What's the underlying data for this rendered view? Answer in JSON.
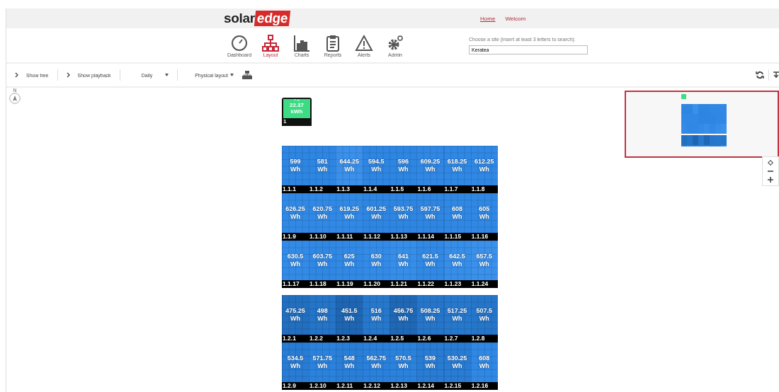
{
  "header": {
    "logo": {
      "part_1": "solar",
      "part_2": "edge"
    },
    "links": [
      {
        "label": "Home",
        "kind": "link"
      },
      {
        "label": "Welcom",
        "kind": "text"
      }
    ]
  },
  "nav": [
    {
      "label": "Dashboard",
      "kind": "gauge",
      "selected": false
    },
    {
      "label": "Layout",
      "kind": "tree",
      "selected": true
    },
    {
      "label": "Charts",
      "kind": "bars",
      "selected": false
    },
    {
      "label": "Reports",
      "kind": "clipboard",
      "selected": false
    },
    {
      "label": "Alerts",
      "kind": "warning",
      "selected": false
    },
    {
      "label": "Admin",
      "kind": "gears",
      "selected": false
    }
  ],
  "site_search": {
    "label": "Choose a site (insert at least 3 letters to search):",
    "value": "Keratea"
  },
  "toolbar": [
    {
      "label": "Show tree",
      "kind": "toggle"
    },
    {
      "label": "Show playback",
      "kind": "toggle"
    },
    {
      "label": "Daily",
      "kind": "dropdown"
    },
    {
      "label": "Physical layout",
      "kind": "menu"
    }
  ],
  "compass": {
    "label": "N"
  },
  "inverter": {
    "value": "22.37",
    "unit": "kWh",
    "id": "1"
  },
  "strings": [
    {
      "rows": [
        [
          {
            "value": "599",
            "unit": "Wh",
            "id": "1.1.1",
            "color": "#2e86e2"
          },
          {
            "value": "581",
            "unit": "Wh",
            "id": "1.1.2",
            "color": "#2e86e2"
          },
          {
            "value": "644.25",
            "unit": "Wh",
            "id": "1.1.3",
            "color": "#3a90ea"
          },
          {
            "value": "594.5",
            "unit": "Wh",
            "id": "1.1.4",
            "color": "#2e86e2"
          },
          {
            "value": "596",
            "unit": "Wh",
            "id": "1.1.5",
            "color": "#2e86e2"
          },
          {
            "value": "609.25",
            "unit": "Wh",
            "id": "1.1.6",
            "color": "#3088e4"
          },
          {
            "value": "618.25",
            "unit": "Wh",
            "id": "1.1.7",
            "color": "#3088e4"
          },
          {
            "value": "612.25",
            "unit": "Wh",
            "id": "1.1.8",
            "color": "#3088e4"
          }
        ],
        [
          {
            "value": "626.25",
            "unit": "Wh",
            "id": "1.1.9",
            "color": "#3189e5"
          },
          {
            "value": "620.75",
            "unit": "Wh",
            "id": "1.1.10",
            "color": "#3189e5"
          },
          {
            "value": "619.25",
            "unit": "Wh",
            "id": "1.1.11",
            "color": "#3189e5"
          },
          {
            "value": "601.25",
            "unit": "Wh",
            "id": "1.1.12",
            "color": "#2e86e2"
          },
          {
            "value": "593.75",
            "unit": "Wh",
            "id": "1.1.13",
            "color": "#2e86e2"
          },
          {
            "value": "597.75",
            "unit": "Wh",
            "id": "1.1.14",
            "color": "#2e86e2"
          },
          {
            "value": "608",
            "unit": "Wh",
            "id": "1.1.15",
            "color": "#3088e4"
          },
          {
            "value": "605",
            "unit": "Wh",
            "id": "1.1.16",
            "color": "#3088e4"
          }
        ],
        [
          {
            "value": "630.5",
            "unit": "Wh",
            "id": "1.1.17",
            "color": "#338be7"
          },
          {
            "value": "603.75",
            "unit": "Wh",
            "id": "1.1.18",
            "color": "#3088e4"
          },
          {
            "value": "625",
            "unit": "Wh",
            "id": "1.1.19",
            "color": "#3189e5"
          },
          {
            "value": "630",
            "unit": "Wh",
            "id": "1.1.20",
            "color": "#338be7"
          },
          {
            "value": "641",
            "unit": "Wh",
            "id": "1.1.21",
            "color": "#368ee9"
          },
          {
            "value": "621.5",
            "unit": "Wh",
            "id": "1.1.22",
            "color": "#3189e5"
          },
          {
            "value": "642.5",
            "unit": "Wh",
            "id": "1.1.23",
            "color": "#368ee9"
          },
          {
            "value": "657.5",
            "unit": "Wh",
            "id": "1.1.24",
            "color": "#3a90ea"
          }
        ]
      ]
    },
    {
      "rows": [
        [
          {
            "value": "475.25",
            "unit": "Wh",
            "id": "1.2.1",
            "color": "#226fc0"
          },
          {
            "value": "498",
            "unit": "Wh",
            "id": "1.2.2",
            "color": "#2474c8"
          },
          {
            "value": "451.5",
            "unit": "Wh",
            "id": "1.2.3",
            "color": "#1e66b3"
          },
          {
            "value": "516",
            "unit": "Wh",
            "id": "1.2.4",
            "color": "#2678cd"
          },
          {
            "value": "456.75",
            "unit": "Wh",
            "id": "1.2.5",
            "color": "#1f68b6"
          },
          {
            "value": "508.25",
            "unit": "Wh",
            "id": "1.2.6",
            "color": "#2576ca"
          },
          {
            "value": "517.25",
            "unit": "Wh",
            "id": "1.2.7",
            "color": "#2678cd"
          },
          {
            "value": "507.5",
            "unit": "Wh",
            "id": "1.2.8",
            "color": "#2576ca"
          }
        ],
        [
          {
            "value": "534.5",
            "unit": "Wh",
            "id": "1.2.9",
            "color": "#287cd4"
          },
          {
            "value": "571.75",
            "unit": "Wh",
            "id": "1.2.10",
            "color": "#2b82dc"
          },
          {
            "value": "548",
            "unit": "Wh",
            "id": "1.2.11",
            "color": "#297ed7"
          },
          {
            "value": "562.75",
            "unit": "Wh",
            "id": "1.2.12",
            "color": "#2a80da"
          },
          {
            "value": "570.5",
            "unit": "Wh",
            "id": "1.2.13",
            "color": "#2b82dc"
          },
          {
            "value": "539",
            "unit": "Wh",
            "id": "1.2.14",
            "color": "#287cd4"
          },
          {
            "value": "530.25",
            "unit": "Wh",
            "id": "1.2.15",
            "color": "#287cd4"
          },
          {
            "value": "608",
            "unit": "Wh",
            "id": "1.2.16",
            "color": "#3088e4"
          }
        ]
      ]
    }
  ]
}
